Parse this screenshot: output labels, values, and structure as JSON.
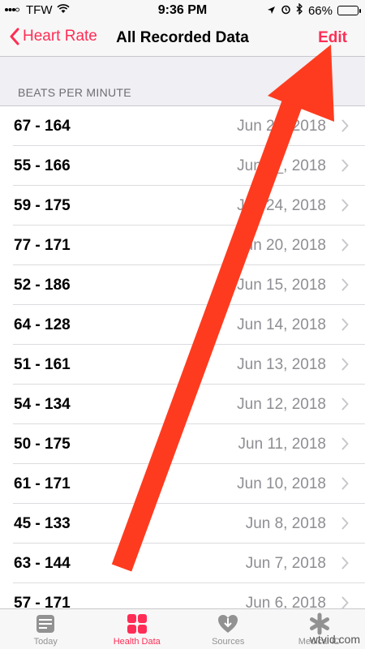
{
  "status": {
    "carrier": "TFW",
    "time": "9:36 PM",
    "battery": "66%",
    "battery_level": 0.66
  },
  "nav": {
    "back_label": "Heart Rate",
    "title": "All Recorded Data",
    "edit_label": "Edit"
  },
  "section_header": "BEATS PER MINUTE",
  "rows": [
    {
      "range": "67 - 164",
      "date": "Jun 27, 2018"
    },
    {
      "range": "55 - 166",
      "date": "Jun 2_, 2018"
    },
    {
      "range": "59 - 175",
      "date": "Jun 24, 2018"
    },
    {
      "range": "77 - 171",
      "date": "Jun 20, 2018"
    },
    {
      "range": "52 - 186",
      "date": "Jun 15, 2018"
    },
    {
      "range": "64 - 128",
      "date": "Jun 14, 2018"
    },
    {
      "range": "51 - 161",
      "date": "Jun 13, 2018"
    },
    {
      "range": "54 - 134",
      "date": "Jun 12, 2018"
    },
    {
      "range": "50 - 175",
      "date": "Jun 11, 2018"
    },
    {
      "range": "61 - 171",
      "date": "Jun 10, 2018"
    },
    {
      "range": "45 - 133",
      "date": "Jun 8, 2018"
    },
    {
      "range": "63 - 144",
      "date": "Jun 7, 2018"
    },
    {
      "range": "57 - 171",
      "date": "Jun 6, 2018"
    }
  ],
  "tabs": [
    {
      "label": "Today",
      "icon": "calendar-icon",
      "active": false
    },
    {
      "label": "Health Data",
      "icon": "grid-icon",
      "active": true
    },
    {
      "label": "Sources",
      "icon": "heart-download-icon",
      "active": false
    },
    {
      "label": "Medical ID",
      "icon": "asterisk-icon",
      "active": false
    }
  ],
  "watermark": "wtvid.com",
  "colors": {
    "accent": "#ff2d55",
    "arrow": "#ff3b1f",
    "secondary_text": "#8e8e93"
  }
}
